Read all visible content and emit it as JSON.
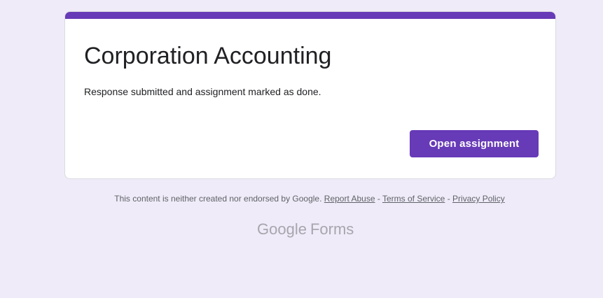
{
  "card": {
    "title": "Corporation Accounting",
    "message": "Response submitted and assignment marked as done.",
    "button_label": "Open assignment"
  },
  "footer": {
    "disclaimer": "This content is neither created nor endorsed by Google.",
    "report_abuse": "Report Abuse",
    "separator": "-",
    "terms": "Terms of Service",
    "privacy": "Privacy Policy"
  },
  "logo": {
    "google": "Google",
    "forms": "Forms"
  },
  "colors": {
    "accent": "#673ab7",
    "background": "#efebf8"
  }
}
